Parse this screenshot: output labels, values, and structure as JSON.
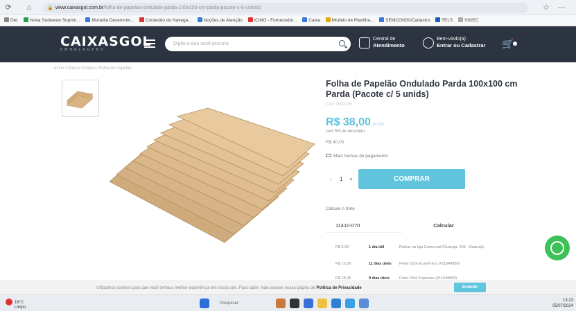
{
  "browser": {
    "url_host": "www.caixasgol.com.br",
    "url_rest": "/folha-de-papelao-ondulado-parda-100x100-cm-parda-pacote-c-5-unids/p",
    "bookmarks": [
      "Del.",
      "Nova Sudoeste Suprim...",
      "Moradia Desenvolv...",
      "Conteúdo do Navega...",
      "Noções de Atenção",
      "iCINO - Fornecedor...",
      "Caixa",
      "Modelo de Planilha...",
      "SEMCONSUCadastro",
      "TELS",
      "SIGEC"
    ]
  },
  "header": {
    "logo": "CAIXASGOL",
    "logo_sub": "EMBALAGENS",
    "search_placeholder": "Digite o que você procura",
    "central_line1": "Central de",
    "central_line2": "Atendimento",
    "welcome_line1": "Bem-vindo(a)",
    "welcome_line2": "Entrar ou Cadastrar"
  },
  "breadcrumb": "Início  /  Outras Chapas  /  Folha de Papelão",
  "product": {
    "title": "Folha de Papelão Ondulado Parda 100x100 cm Parda (Pacote c/ 5 unids)",
    "code": "Cód: 1602136",
    "price": "R$ 38,00",
    "price_note": "no pix",
    "discount": "com 5% de desconto",
    "old_price": "R$ 40,00",
    "payment_link": "Mais formas de pagamento",
    "qty_minus": "-",
    "qty_value": "1",
    "qty_plus": "+",
    "buy_label": "COMPRAR"
  },
  "shipping": {
    "label": "Calcule o frete",
    "cep": "11410-070",
    "calc_label": "Calcular",
    "rows": [
      {
        "price": "R$ 0,00",
        "days": "1 dia útil",
        "desc": "Retirar na loja Comercial (Guarujá, 209 - Guarujá)"
      },
      {
        "price": "R$ 15,20",
        "days": "11 dias úteis",
        "desc": "Frete Click Econômico (#11649808)"
      },
      {
        "price": "R$ 28,36",
        "days": "9 dias úteis",
        "desc": "Frete Click Expresso (#11649808)"
      }
    ]
  },
  "cookie": {
    "text": "Utilizamos cookies para que você tenha a melhor experiência em nosso site. Para saber mais acesse nossa página de",
    "policy": "Política de Privacidade",
    "button": "Entendi"
  },
  "taskbar": {
    "weather_temp": "16°C",
    "weather_desc": "Limpo",
    "search": "Pesquisar",
    "time": "13:23",
    "date": "05/07/2024"
  }
}
